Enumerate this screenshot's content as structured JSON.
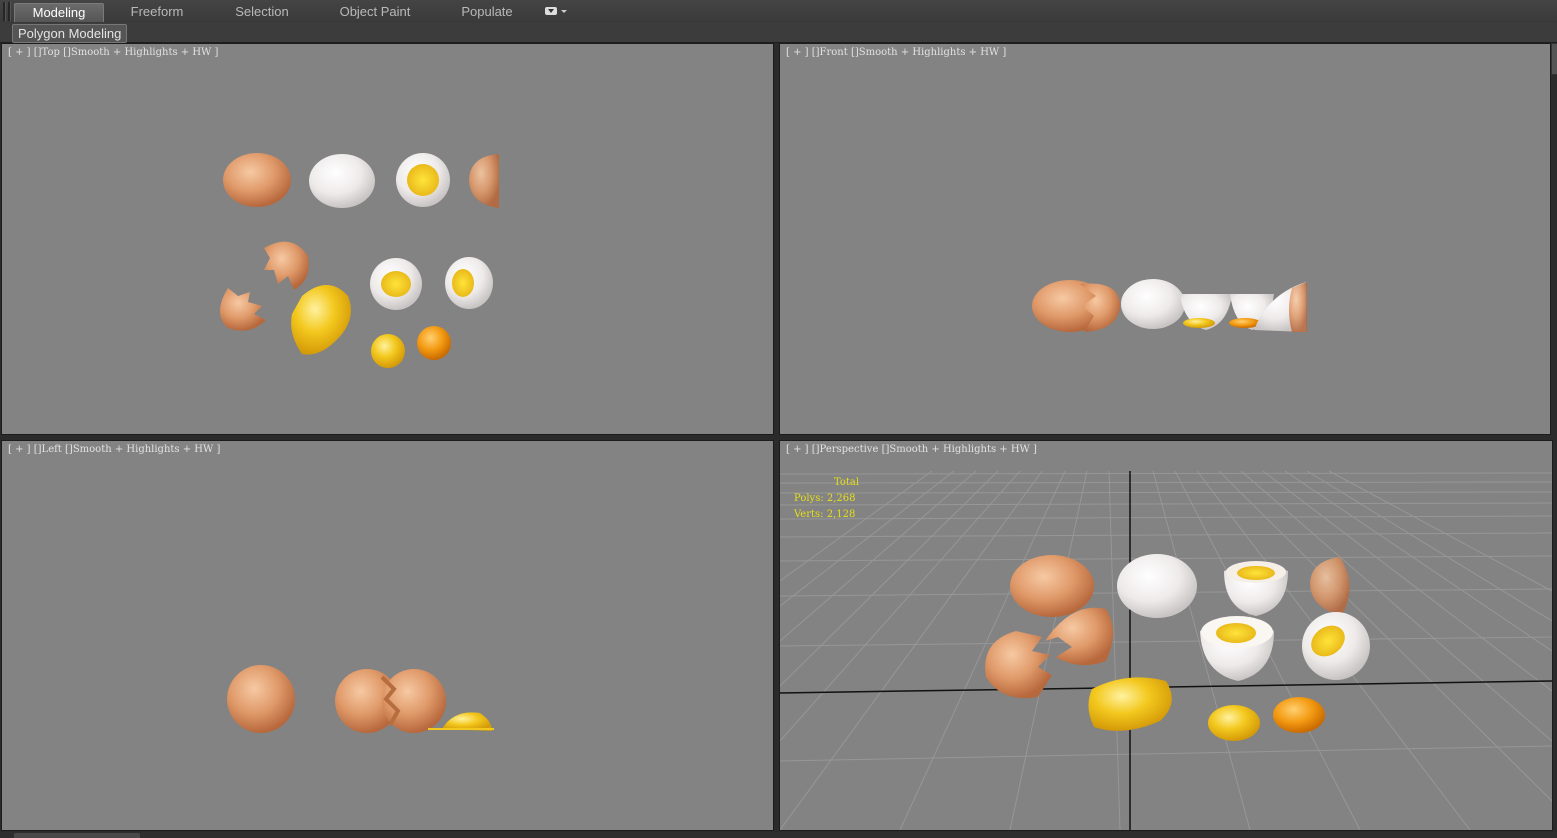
{
  "ribbon": {
    "tabs": [
      {
        "label": "Modeling",
        "active": true
      },
      {
        "label": "Freeform",
        "active": false
      },
      {
        "label": "Selection",
        "active": false
      },
      {
        "label": "Object Paint",
        "active": false
      },
      {
        "label": "Populate",
        "active": false
      }
    ],
    "more_icon": "ribbon-options-icon",
    "panel_label": "Polygon Modeling"
  },
  "viewports": {
    "top": {
      "plus": "[ + ]",
      "view": "Top",
      "shading": "Smooth + Highlights + HW ]",
      "sep": "[]"
    },
    "front": {
      "plus": "[ + ]",
      "view": "Front",
      "shading": "Smooth + Highlights + HW ]",
      "sep": "[]"
    },
    "left": {
      "plus": "[ + ]",
      "view": "Left",
      "shading": "Smooth + Highlights + HW ]",
      "sep": "[]"
    },
    "persp": {
      "plus": "[ + ]",
      "view": "Perspective",
      "shading": "Smooth + Highlights + HW ]",
      "sep": "[]"
    }
  },
  "stats": {
    "title": "Total",
    "polys_label": "Polys:",
    "polys_value": "2,268",
    "verts_label": "Verts:",
    "verts_value": "2,128"
  },
  "colors": {
    "viewport_bg": "#838383",
    "stats_text": "#e6df1a",
    "shell_brown": "#d99566",
    "shell_white": "#f2f2f2",
    "yolk": "#f2c31c"
  }
}
